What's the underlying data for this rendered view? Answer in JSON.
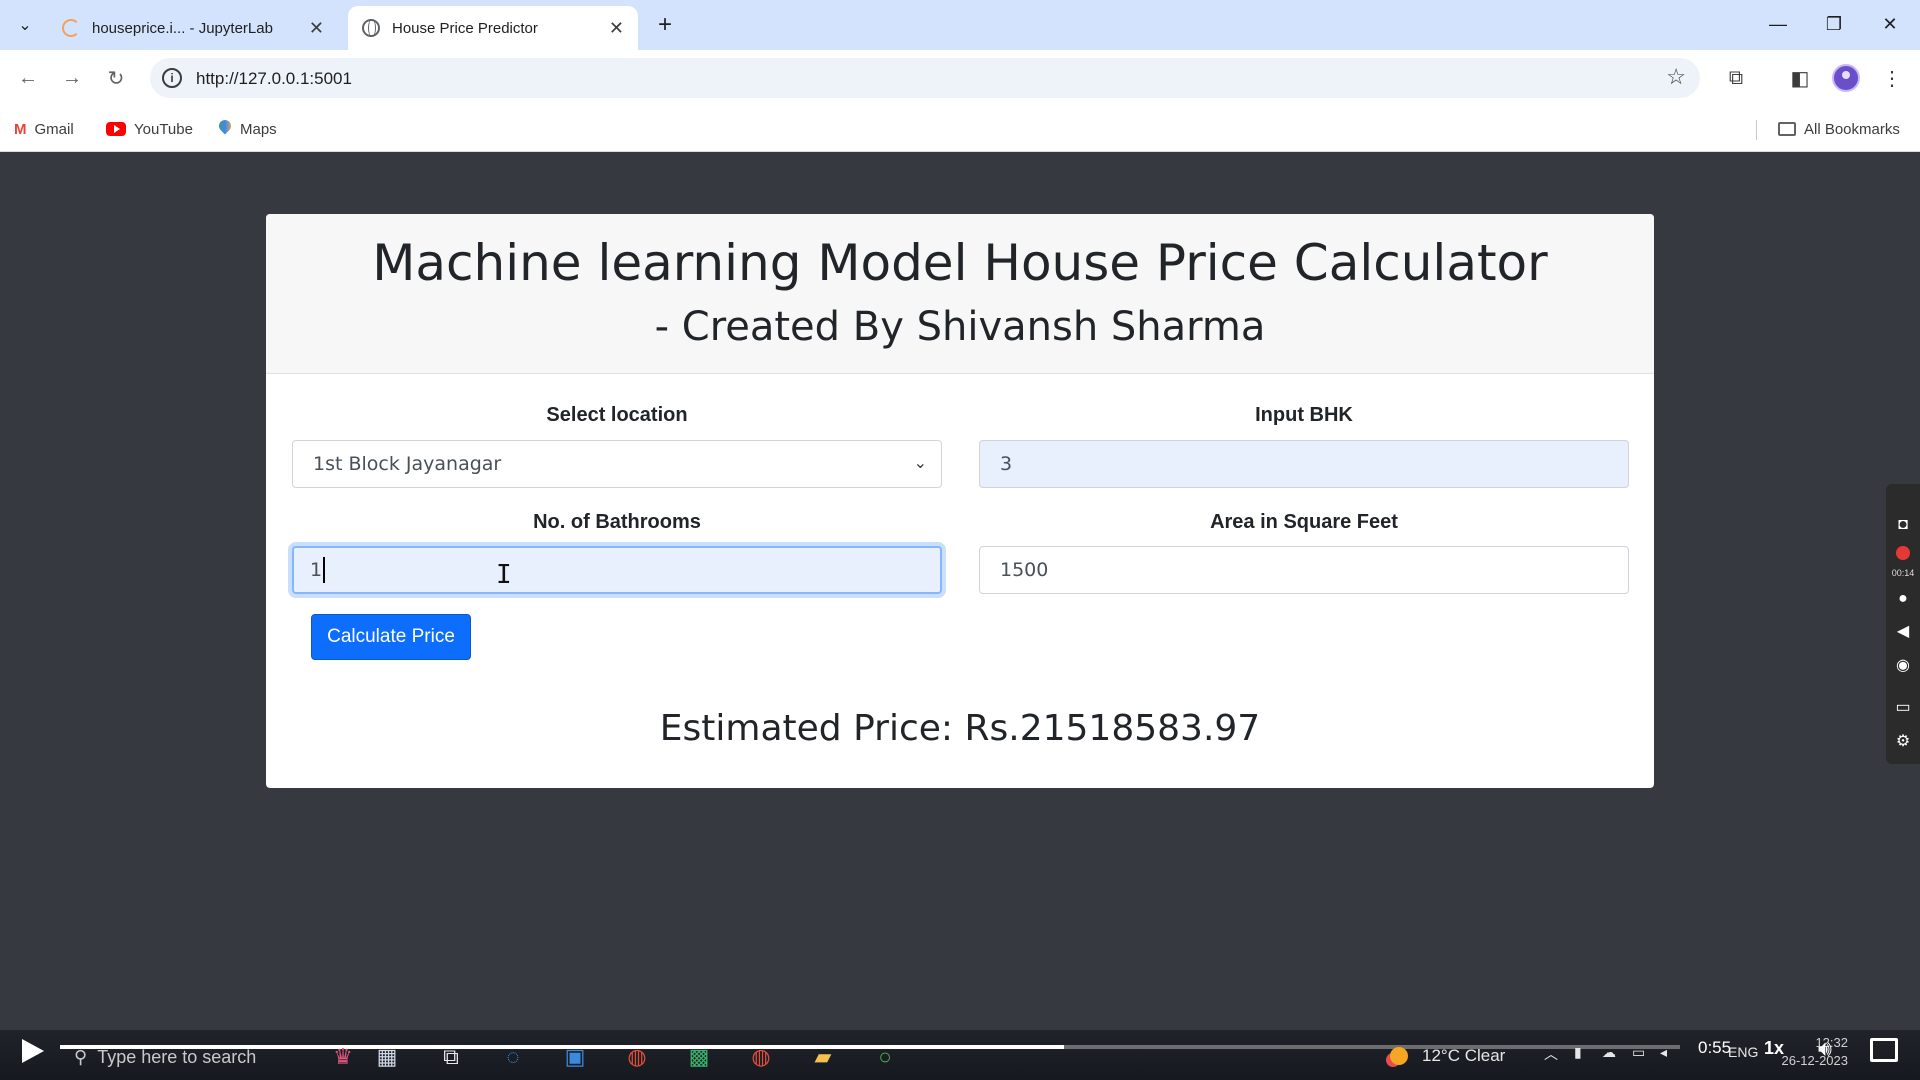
{
  "browser": {
    "tabs": [
      {
        "label": "houseprice.i... - JupyterLab",
        "active": false,
        "icon": "loading-spinner-icon"
      },
      {
        "label": "House Price Predictor",
        "active": true,
        "icon": "globe-icon"
      }
    ],
    "url": "http://127.0.0.1:5001",
    "bookmarks": [
      {
        "label": "Gmail",
        "icon": "gmail-icon"
      },
      {
        "label": "YouTube",
        "icon": "youtube-icon"
      },
      {
        "label": "Maps",
        "icon": "maps-icon"
      }
    ],
    "all_bookmarks_label": "All Bookmarks",
    "tab_close_glyph": "✕",
    "new_tab_glyph": "+"
  },
  "page": {
    "title": "Machine learning Model House Price Calculator",
    "subtitle": "- Created By Shivansh Sharma",
    "form": {
      "location_label": "Select location",
      "location_value": "1st Block Jayanagar",
      "bhk_label": "Input BHK",
      "bhk_value": "3",
      "bathrooms_label": "No. of Bathrooms",
      "bathrooms_value": "1",
      "area_label": "Area in Square Feet",
      "area_value": "1500",
      "submit_label": "Calculate Price"
    },
    "result": "Estimated Price: Rs.21518583.97"
  },
  "recorder": {
    "time": "00:14"
  },
  "player": {
    "current_time": "0:55",
    "speed": "1x",
    "progress_fraction": 0.62
  },
  "taskbar": {
    "search_placeholder": "Type here to search",
    "weather": "12°C  Clear",
    "language": "ENG",
    "clock_time": "12:32",
    "clock_date": "26-12-2023"
  },
  "colors": {
    "page_background": "#36393f",
    "button_primary": "#0d6efd",
    "tabstrip": "#d3e3fd"
  }
}
